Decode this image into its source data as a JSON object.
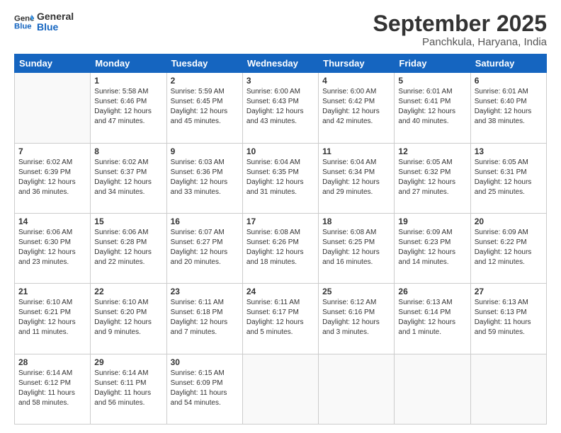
{
  "logo": {
    "line1": "General",
    "line2": "Blue"
  },
  "title": "September 2025",
  "location": "Panchkula, Haryana, India",
  "days_header": [
    "Sunday",
    "Monday",
    "Tuesday",
    "Wednesday",
    "Thursday",
    "Friday",
    "Saturday"
  ],
  "weeks": [
    [
      {
        "num": "",
        "info": ""
      },
      {
        "num": "1",
        "info": "Sunrise: 5:58 AM\nSunset: 6:46 PM\nDaylight: 12 hours\nand 47 minutes."
      },
      {
        "num": "2",
        "info": "Sunrise: 5:59 AM\nSunset: 6:45 PM\nDaylight: 12 hours\nand 45 minutes."
      },
      {
        "num": "3",
        "info": "Sunrise: 6:00 AM\nSunset: 6:43 PM\nDaylight: 12 hours\nand 43 minutes."
      },
      {
        "num": "4",
        "info": "Sunrise: 6:00 AM\nSunset: 6:42 PM\nDaylight: 12 hours\nand 42 minutes."
      },
      {
        "num": "5",
        "info": "Sunrise: 6:01 AM\nSunset: 6:41 PM\nDaylight: 12 hours\nand 40 minutes."
      },
      {
        "num": "6",
        "info": "Sunrise: 6:01 AM\nSunset: 6:40 PM\nDaylight: 12 hours\nand 38 minutes."
      }
    ],
    [
      {
        "num": "7",
        "info": "Sunrise: 6:02 AM\nSunset: 6:39 PM\nDaylight: 12 hours\nand 36 minutes."
      },
      {
        "num": "8",
        "info": "Sunrise: 6:02 AM\nSunset: 6:37 PM\nDaylight: 12 hours\nand 34 minutes."
      },
      {
        "num": "9",
        "info": "Sunrise: 6:03 AM\nSunset: 6:36 PM\nDaylight: 12 hours\nand 33 minutes."
      },
      {
        "num": "10",
        "info": "Sunrise: 6:04 AM\nSunset: 6:35 PM\nDaylight: 12 hours\nand 31 minutes."
      },
      {
        "num": "11",
        "info": "Sunrise: 6:04 AM\nSunset: 6:34 PM\nDaylight: 12 hours\nand 29 minutes."
      },
      {
        "num": "12",
        "info": "Sunrise: 6:05 AM\nSunset: 6:32 PM\nDaylight: 12 hours\nand 27 minutes."
      },
      {
        "num": "13",
        "info": "Sunrise: 6:05 AM\nSunset: 6:31 PM\nDaylight: 12 hours\nand 25 minutes."
      }
    ],
    [
      {
        "num": "14",
        "info": "Sunrise: 6:06 AM\nSunset: 6:30 PM\nDaylight: 12 hours\nand 23 minutes."
      },
      {
        "num": "15",
        "info": "Sunrise: 6:06 AM\nSunset: 6:28 PM\nDaylight: 12 hours\nand 22 minutes."
      },
      {
        "num": "16",
        "info": "Sunrise: 6:07 AM\nSunset: 6:27 PM\nDaylight: 12 hours\nand 20 minutes."
      },
      {
        "num": "17",
        "info": "Sunrise: 6:08 AM\nSunset: 6:26 PM\nDaylight: 12 hours\nand 18 minutes."
      },
      {
        "num": "18",
        "info": "Sunrise: 6:08 AM\nSunset: 6:25 PM\nDaylight: 12 hours\nand 16 minutes."
      },
      {
        "num": "19",
        "info": "Sunrise: 6:09 AM\nSunset: 6:23 PM\nDaylight: 12 hours\nand 14 minutes."
      },
      {
        "num": "20",
        "info": "Sunrise: 6:09 AM\nSunset: 6:22 PM\nDaylight: 12 hours\nand 12 minutes."
      }
    ],
    [
      {
        "num": "21",
        "info": "Sunrise: 6:10 AM\nSunset: 6:21 PM\nDaylight: 12 hours\nand 11 minutes."
      },
      {
        "num": "22",
        "info": "Sunrise: 6:10 AM\nSunset: 6:20 PM\nDaylight: 12 hours\nand 9 minutes."
      },
      {
        "num": "23",
        "info": "Sunrise: 6:11 AM\nSunset: 6:18 PM\nDaylight: 12 hours\nand 7 minutes."
      },
      {
        "num": "24",
        "info": "Sunrise: 6:11 AM\nSunset: 6:17 PM\nDaylight: 12 hours\nand 5 minutes."
      },
      {
        "num": "25",
        "info": "Sunrise: 6:12 AM\nSunset: 6:16 PM\nDaylight: 12 hours\nand 3 minutes."
      },
      {
        "num": "26",
        "info": "Sunrise: 6:13 AM\nSunset: 6:14 PM\nDaylight: 12 hours\nand 1 minute."
      },
      {
        "num": "27",
        "info": "Sunrise: 6:13 AM\nSunset: 6:13 PM\nDaylight: 11 hours\nand 59 minutes."
      }
    ],
    [
      {
        "num": "28",
        "info": "Sunrise: 6:14 AM\nSunset: 6:12 PM\nDaylight: 11 hours\nand 58 minutes."
      },
      {
        "num": "29",
        "info": "Sunrise: 6:14 AM\nSunset: 6:11 PM\nDaylight: 11 hours\nand 56 minutes."
      },
      {
        "num": "30",
        "info": "Sunrise: 6:15 AM\nSunset: 6:09 PM\nDaylight: 11 hours\nand 54 minutes."
      },
      {
        "num": "",
        "info": ""
      },
      {
        "num": "",
        "info": ""
      },
      {
        "num": "",
        "info": ""
      },
      {
        "num": "",
        "info": ""
      }
    ]
  ]
}
